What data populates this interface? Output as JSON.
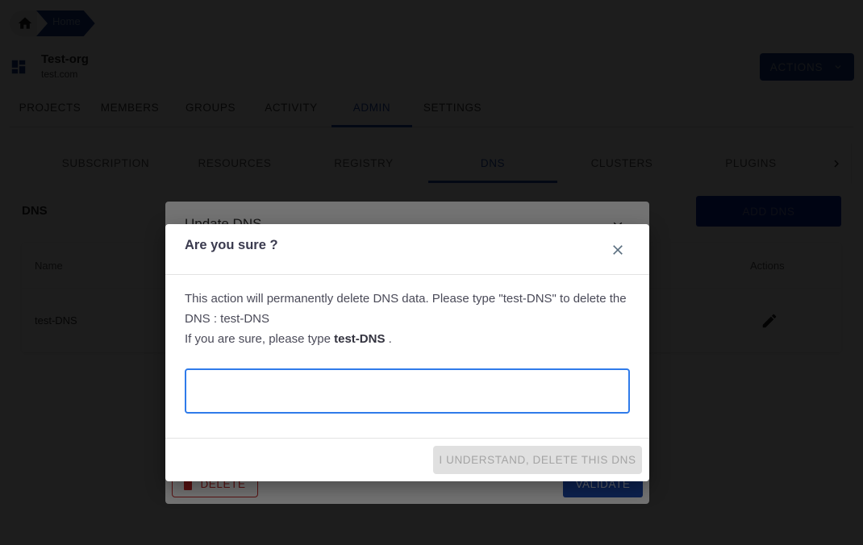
{
  "breadcrumb": {
    "home_icon": "home-icon",
    "items": [
      {
        "label": "Home"
      }
    ]
  },
  "org": {
    "icon": "dashboard-icon",
    "name": "Test-org",
    "domain": "test.com"
  },
  "header_actions": {
    "label": "ACTIONS",
    "icon": "chevron-down-icon"
  },
  "main_tabs": [
    {
      "label": "PROJECTS",
      "active": false
    },
    {
      "label": "MEMBERS",
      "active": false
    },
    {
      "label": "GROUPS",
      "active": false
    },
    {
      "label": "ACTIVITY",
      "active": false
    },
    {
      "label": "ADMIN",
      "active": true
    },
    {
      "label": "SETTINGS",
      "active": false
    }
  ],
  "sub_tabs": [
    {
      "label": "SUBSCRIPTION",
      "active": false
    },
    {
      "label": "RESOURCES",
      "active": false
    },
    {
      "label": "REGISTRY",
      "active": false
    },
    {
      "label": "DNS",
      "active": true
    },
    {
      "label": "CLUSTERS",
      "active": false
    },
    {
      "label": "PLUGINS",
      "active": false
    }
  ],
  "sub_tabs_next_icon": "chevron-right-icon",
  "dns_section": {
    "title": "DNS",
    "add_button": "ADD DNS",
    "table": {
      "columns": [
        "Name",
        "Actions"
      ],
      "rows": [
        {
          "name": "test-DNS",
          "action_icon": "pencil-icon"
        }
      ]
    }
  },
  "update_dialog": {
    "title": "Update DNS",
    "delete_label": "DELETE",
    "validate_label": "VALIDATE"
  },
  "confirm_dialog": {
    "title": "Are you sure ?",
    "message_line1": "This action will permanently delete DNS data. Please type \"test-DNS\" to delete the DNS : test-DNS",
    "message_prefix": "If you are sure, please type ",
    "confirm_name": "test-DNS",
    "message_suffix": " .",
    "input_value": "",
    "input_placeholder": "",
    "confirm_button": "I UNDERSTAND, DELETE THIS DNS",
    "confirm_button_enabled": false
  },
  "colors": {
    "primary": "#1c4bb0",
    "danger": "#c62828",
    "focus": "#2f7bea"
  }
}
